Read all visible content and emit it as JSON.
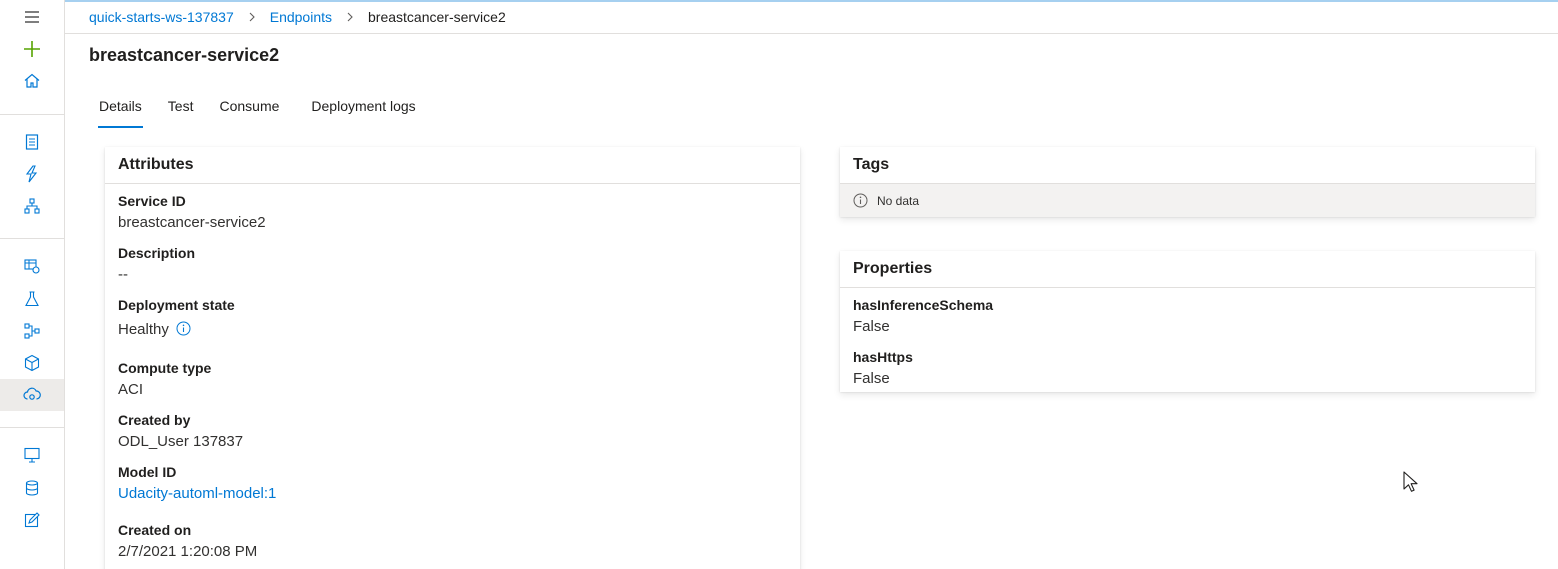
{
  "breadcrumb": {
    "items": [
      "quick-starts-ws-137837",
      "Endpoints"
    ],
    "current": "breastcancer-service2"
  },
  "page": {
    "title": "breastcancer-service2"
  },
  "tabs": [
    {
      "label": "Details",
      "active": true
    },
    {
      "label": "Test",
      "active": false
    },
    {
      "label": "Consume",
      "active": false
    },
    {
      "label": "Deployment logs",
      "active": false
    }
  ],
  "attributes": {
    "title": "Attributes",
    "service_id": {
      "label": "Service ID",
      "value": "breastcancer-service2"
    },
    "description": {
      "label": "Description",
      "value": "--"
    },
    "deployment_state": {
      "label": "Deployment state",
      "value": "Healthy"
    },
    "compute_type": {
      "label": "Compute type",
      "value": "ACI"
    },
    "created_by": {
      "label": "Created by",
      "value": "ODL_User 137837"
    },
    "model_id": {
      "label": "Model ID",
      "value": "Udacity-automl-model:1"
    },
    "created_on": {
      "label": "Created on",
      "value": "2/7/2021 1:20:08 PM"
    }
  },
  "tags": {
    "title": "Tags",
    "empty_text": "No data"
  },
  "properties": {
    "title": "Properties",
    "items": [
      {
        "label": "hasInferenceSchema",
        "value": "False"
      },
      {
        "label": "hasHttps",
        "value": "False"
      }
    ]
  },
  "rail": {
    "icons": [
      "hamburger-menu-icon",
      "add-icon",
      "home-icon",
      "notebooks-icon",
      "automl-icon",
      "designer-icon",
      "datasets-icon",
      "experiments-icon",
      "pipelines-icon",
      "models-icon",
      "endpoints-icon",
      "compute-icon",
      "datastores-icon",
      "data-labeling-icon"
    ],
    "active": "endpoints-icon"
  },
  "colors": {
    "accent": "#0078d4",
    "add_icon": "#57a300",
    "text": "#201f1e"
  }
}
